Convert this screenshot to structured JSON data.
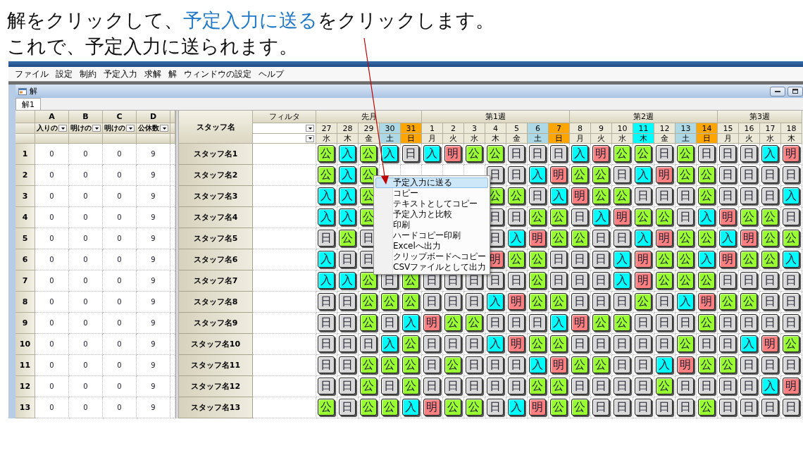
{
  "instruction": {
    "lines": [
      [
        {
          "text": "解をクリックして、",
          "highlight": false
        },
        {
          "text": "予定入力に送る",
          "highlight": true
        },
        {
          "text": "をクリックします。",
          "highlight": false
        }
      ],
      [
        {
          "text": "これで、予定入力に送られます。",
          "highlight": false
        }
      ]
    ]
  },
  "menu_bar": [
    "ファイル",
    "設定",
    "制約",
    "予定入力",
    "求解",
    "解",
    "ウィンドウの設定",
    "ヘルプ"
  ],
  "child_window": {
    "title": "解",
    "tabs": [
      {
        "label": "解1",
        "selected": true
      }
    ]
  },
  "summary_table": {
    "columns": [
      {
        "letter": "A",
        "label": "入りの"
      },
      {
        "letter": "B",
        "label": "明けの"
      },
      {
        "letter": "C",
        "label": "明けの"
      },
      {
        "letter": "D",
        "label": "公休数"
      }
    ]
  },
  "schedule": {
    "name_header": "スタッフ名",
    "filter_header": "フィルタ",
    "weeks": [
      {
        "label": "先月",
        "days": [
          {
            "date": "27",
            "weekday": "水",
            "kind": "weekday"
          },
          {
            "date": "28",
            "weekday": "木",
            "kind": "weekday"
          },
          {
            "date": "29",
            "weekday": "金",
            "kind": "weekday"
          },
          {
            "date": "30",
            "weekday": "土",
            "kind": "saturday"
          },
          {
            "date": "31",
            "weekday": "日",
            "kind": "sunday"
          }
        ]
      },
      {
        "label": "第1週",
        "days": [
          {
            "date": "1",
            "weekday": "月",
            "kind": "weekday"
          },
          {
            "date": "2",
            "weekday": "火",
            "kind": "weekday"
          },
          {
            "date": "3",
            "weekday": "水",
            "kind": "weekday"
          },
          {
            "date": "4",
            "weekday": "木",
            "kind": "weekday"
          },
          {
            "date": "5",
            "weekday": "金",
            "kind": "weekday"
          },
          {
            "date": "6",
            "weekday": "土",
            "kind": "saturday"
          },
          {
            "date": "7",
            "weekday": "日",
            "kind": "sunday"
          }
        ]
      },
      {
        "label": "第2週",
        "days": [
          {
            "date": "8",
            "weekday": "月",
            "kind": "weekday"
          },
          {
            "date": "9",
            "weekday": "火",
            "kind": "weekday"
          },
          {
            "date": "10",
            "weekday": "水",
            "kind": "weekday"
          },
          {
            "date": "11",
            "weekday": "木",
            "kind": "holiday"
          },
          {
            "date": "12",
            "weekday": "金",
            "kind": "weekday"
          },
          {
            "date": "13",
            "weekday": "土",
            "kind": "saturday"
          },
          {
            "date": "14",
            "weekday": "日",
            "kind": "sunday"
          }
        ]
      },
      {
        "label": "第3週",
        "days": [
          {
            "date": "15",
            "weekday": "月",
            "kind": "weekday"
          },
          {
            "date": "16",
            "weekday": "火",
            "kind": "weekday"
          },
          {
            "date": "17",
            "weekday": "水",
            "kind": "weekday"
          },
          {
            "date": "18",
            "weekday": "木",
            "kind": "weekday"
          }
        ]
      }
    ]
  },
  "rows": [
    {
      "number": "1",
      "values": [
        "0",
        "0",
        "0",
        "9"
      ],
      "staff": "スタッフ名1",
      "shifts": [
        {
          "label": "公",
          "color": "#99ff33"
        },
        {
          "label": "入",
          "color": "#00ffff"
        },
        {
          "label": "公",
          "color": "#99ff33"
        },
        {
          "label": "入",
          "color": "#00ffff"
        },
        {
          "label": "日",
          "color": "#d9d9d9"
        },
        {
          "label": "入",
          "color": "#00ffff"
        },
        {
          "label": "明",
          "color": "#ff8080"
        },
        {
          "label": "公",
          "color": "#99ff33"
        },
        {
          "label": "公",
          "color": "#99ff33"
        },
        {
          "label": "日",
          "color": "#d9d9d9"
        },
        {
          "label": "日",
          "color": "#d9d9d9"
        },
        {
          "label": "日",
          "color": "#d9d9d9"
        },
        {
          "label": "入",
          "color": "#00ffff"
        },
        {
          "label": "明",
          "color": "#ff8080"
        },
        {
          "label": "公",
          "color": "#99ff33"
        },
        {
          "label": "公",
          "color": "#99ff33"
        },
        {
          "label": "日",
          "color": "#d9d9d9"
        },
        {
          "label": "公",
          "color": "#99ff33"
        },
        {
          "label": "日",
          "color": "#d9d9d9"
        },
        {
          "label": "日",
          "color": "#d9d9d9"
        },
        {
          "label": "日",
          "color": "#d9d9d9"
        },
        {
          "label": "入",
          "color": "#00ffff"
        },
        {
          "label": "明",
          "color": "#ff8080"
        }
      ]
    },
    {
      "number": "2",
      "values": [
        "0",
        "0",
        "0",
        "9"
      ],
      "staff": "スタッフ名2",
      "shifts": [
        {
          "label": "公",
          "color": "#99ff33"
        },
        {
          "label": "入",
          "color": "#00ffff"
        },
        {
          "label": "公",
          "color": "#99ff33"
        }
      ],
      "shifts_right": [
        {
          "label": "日",
          "color": "#d9d9d9"
        },
        {
          "label": "日",
          "color": "#d9d9d9"
        },
        {
          "label": "入",
          "color": "#00ffff"
        },
        {
          "label": "明",
          "color": "#ff8080"
        },
        {
          "label": "公",
          "color": "#99ff33"
        },
        {
          "label": "公",
          "color": "#99ff33"
        },
        {
          "label": "日",
          "color": "#d9d9d9"
        },
        {
          "label": "入",
          "color": "#00ffff"
        },
        {
          "label": "明",
          "color": "#ff8080"
        },
        {
          "label": "公",
          "color": "#99ff33"
        },
        {
          "label": "公",
          "color": "#99ff33"
        },
        {
          "label": "日",
          "color": "#d9d9d9"
        },
        {
          "label": "日",
          "color": "#d9d9d9"
        },
        {
          "label": "日",
          "color": "#d9d9d9"
        },
        {
          "label": "日",
          "color": "#d9d9d9"
        }
      ]
    },
    {
      "number": "3",
      "values": [
        "0",
        "0",
        "0",
        "9"
      ],
      "staff": "スタッフ名3",
      "shifts": [
        {
          "label": "入",
          "color": "#00ffff"
        },
        {
          "label": "入",
          "color": "#00ffff"
        },
        {
          "label": "公",
          "color": "#99ff33"
        }
      ],
      "shifts_right": [
        {
          "label": "公",
          "color": "#99ff33"
        },
        {
          "label": "公",
          "color": "#99ff33"
        },
        {
          "label": "日",
          "color": "#d9d9d9"
        },
        {
          "label": "入",
          "color": "#00ffff"
        },
        {
          "label": "明",
          "color": "#ff8080"
        },
        {
          "label": "公",
          "color": "#99ff33"
        },
        {
          "label": "公",
          "color": "#99ff33"
        },
        {
          "label": "日",
          "color": "#d9d9d9"
        },
        {
          "label": "日",
          "color": "#d9d9d9"
        },
        {
          "label": "日",
          "color": "#d9d9d9"
        },
        {
          "label": "公",
          "color": "#99ff33"
        },
        {
          "label": "日",
          "color": "#d9d9d9"
        },
        {
          "label": "日",
          "color": "#d9d9d9"
        },
        {
          "label": "日",
          "color": "#d9d9d9"
        },
        {
          "label": "入",
          "color": "#00ffff"
        }
      ]
    },
    {
      "number": "4",
      "values": [
        "0",
        "0",
        "0",
        "9"
      ],
      "staff": "スタッフ名4",
      "shifts": [
        {
          "label": "入",
          "color": "#00ffff"
        },
        {
          "label": "入",
          "color": "#00ffff"
        },
        {
          "label": "公",
          "color": "#99ff33"
        }
      ],
      "shifts_right": [
        {
          "label": "日",
          "color": "#d9d9d9"
        },
        {
          "label": "日",
          "color": "#d9d9d9"
        },
        {
          "label": "公",
          "color": "#99ff33"
        },
        {
          "label": "公",
          "color": "#99ff33"
        },
        {
          "label": "日",
          "color": "#d9d9d9"
        },
        {
          "label": "入",
          "color": "#00ffff"
        },
        {
          "label": "明",
          "color": "#ff8080"
        },
        {
          "label": "公",
          "color": "#99ff33"
        },
        {
          "label": "公",
          "color": "#99ff33"
        },
        {
          "label": "日",
          "color": "#d9d9d9"
        },
        {
          "label": "入",
          "color": "#00ffff"
        },
        {
          "label": "明",
          "color": "#ff8080"
        },
        {
          "label": "公",
          "color": "#99ff33"
        },
        {
          "label": "公",
          "color": "#99ff33"
        },
        {
          "label": "日",
          "color": "#d9d9d9"
        }
      ]
    },
    {
      "number": "5",
      "values": [
        "0",
        "0",
        "0",
        "9"
      ],
      "staff": "スタッフ名5",
      "shifts": [
        {
          "label": "日",
          "color": "#d9d9d9"
        },
        {
          "label": "公",
          "color": "#99ff33"
        },
        {
          "label": "日",
          "color": "#d9d9d9"
        }
      ],
      "shifts_right": [
        {
          "label": "日",
          "color": "#d9d9d9"
        },
        {
          "label": "入",
          "color": "#00ffff"
        },
        {
          "label": "明",
          "color": "#ff8080"
        },
        {
          "label": "公",
          "color": "#99ff33"
        },
        {
          "label": "公",
          "color": "#99ff33"
        },
        {
          "label": "日",
          "color": "#d9d9d9"
        },
        {
          "label": "日",
          "color": "#d9d9d9"
        },
        {
          "label": "入",
          "color": "#00ffff"
        },
        {
          "label": "明",
          "color": "#ff8080"
        },
        {
          "label": "公",
          "color": "#99ff33"
        },
        {
          "label": "公",
          "color": "#99ff33"
        },
        {
          "label": "入",
          "color": "#00ffff"
        },
        {
          "label": "明",
          "color": "#ff8080"
        },
        {
          "label": "公",
          "color": "#99ff33"
        },
        {
          "label": "公",
          "color": "#99ff33"
        }
      ]
    },
    {
      "number": "6",
      "values": [
        "0",
        "0",
        "0",
        "9"
      ],
      "staff": "スタッフ名6",
      "shifts": [
        {
          "label": "入",
          "color": "#00ffff"
        },
        {
          "label": "日",
          "color": "#d9d9d9"
        },
        {
          "label": "日",
          "color": "#d9d9d9"
        }
      ],
      "shifts_right": [
        {
          "label": "明",
          "color": "#ff8080"
        },
        {
          "label": "公",
          "color": "#99ff33"
        },
        {
          "label": "公",
          "color": "#99ff33"
        },
        {
          "label": "日",
          "color": "#d9d9d9"
        },
        {
          "label": "日",
          "color": "#d9d9d9"
        },
        {
          "label": "日",
          "color": "#d9d9d9"
        },
        {
          "label": "入",
          "color": "#00ffff"
        },
        {
          "label": "明",
          "color": "#ff8080"
        },
        {
          "label": "公",
          "color": "#99ff33"
        },
        {
          "label": "公",
          "color": "#99ff33"
        },
        {
          "label": "入",
          "color": "#00ffff"
        },
        {
          "label": "明",
          "color": "#ff8080"
        },
        {
          "label": "公",
          "color": "#99ff33"
        },
        {
          "label": "公",
          "color": "#99ff33"
        },
        {
          "label": "入",
          "color": "#00ffff"
        }
      ]
    },
    {
      "number": "7",
      "values": [
        "0",
        "0",
        "0",
        "9"
      ],
      "staff": "スタッフ名7",
      "shifts": [
        {
          "label": "入",
          "color": "#00ffff"
        },
        {
          "label": "入",
          "color": "#00ffff"
        },
        {
          "label": "公",
          "color": "#99ff33"
        },
        {
          "label": "日",
          "color": "#d9d9d9"
        },
        {
          "label": "公",
          "color": "#99ff33"
        },
        {
          "label": "日",
          "color": "#d9d9d9"
        },
        {
          "label": "日",
          "color": "#d9d9d9"
        },
        {
          "label": "日",
          "color": "#d9d9d9"
        },
        {
          "label": "日",
          "color": "#d9d9d9"
        },
        {
          "label": "日",
          "color": "#d9d9d9"
        },
        {
          "label": "公",
          "color": "#99ff33"
        },
        {
          "label": "日",
          "color": "#d9d9d9"
        },
        {
          "label": "日",
          "color": "#d9d9d9"
        },
        {
          "label": "日",
          "color": "#d9d9d9"
        },
        {
          "label": "入",
          "color": "#00ffff"
        },
        {
          "label": "明",
          "color": "#ff8080"
        },
        {
          "label": "公",
          "color": "#99ff33"
        },
        {
          "label": "公",
          "color": "#99ff33"
        },
        {
          "label": "公",
          "color": "#99ff33"
        },
        {
          "label": "日",
          "color": "#d9d9d9"
        },
        {
          "label": "日",
          "color": "#d9d9d9"
        },
        {
          "label": "日",
          "color": "#d9d9d9"
        },
        {
          "label": "日",
          "color": "#d9d9d9"
        }
      ]
    },
    {
      "number": "8",
      "values": [
        "0",
        "0",
        "0",
        "9"
      ],
      "staff": "スタッフ名8",
      "shifts": [
        {
          "label": "日",
          "color": "#d9d9d9"
        },
        {
          "label": "日",
          "color": "#d9d9d9"
        },
        {
          "label": "公",
          "color": "#99ff33"
        },
        {
          "label": "公",
          "color": "#99ff33"
        },
        {
          "label": "公",
          "color": "#99ff33"
        },
        {
          "label": "日",
          "color": "#d9d9d9"
        },
        {
          "label": "日",
          "color": "#d9d9d9"
        },
        {
          "label": "日",
          "color": "#d9d9d9"
        },
        {
          "label": "入",
          "color": "#00ffff"
        },
        {
          "label": "明",
          "color": "#ff8080"
        },
        {
          "label": "公",
          "color": "#99ff33"
        },
        {
          "label": "公",
          "color": "#99ff33"
        },
        {
          "label": "日",
          "color": "#d9d9d9"
        },
        {
          "label": "日",
          "color": "#d9d9d9"
        },
        {
          "label": "日",
          "color": "#d9d9d9"
        },
        {
          "label": "公",
          "color": "#99ff33"
        },
        {
          "label": "日",
          "color": "#d9d9d9"
        },
        {
          "label": "入",
          "color": "#00ffff"
        },
        {
          "label": "明",
          "color": "#ff8080"
        },
        {
          "label": "公",
          "color": "#99ff33"
        },
        {
          "label": "公",
          "color": "#99ff33"
        },
        {
          "label": "日",
          "color": "#d9d9d9"
        },
        {
          "label": "日",
          "color": "#d9d9d9"
        }
      ]
    },
    {
      "number": "9",
      "values": [
        "0",
        "0",
        "0",
        "9"
      ],
      "staff": "スタッフ名9",
      "shifts": [
        {
          "label": "日",
          "color": "#d9d9d9"
        },
        {
          "label": "日",
          "color": "#d9d9d9"
        },
        {
          "label": "公",
          "color": "#99ff33"
        },
        {
          "label": "日",
          "color": "#d9d9d9"
        },
        {
          "label": "入",
          "color": "#00ffff"
        },
        {
          "label": "明",
          "color": "#ff8080"
        },
        {
          "label": "公",
          "color": "#99ff33"
        },
        {
          "label": "公",
          "color": "#99ff33"
        },
        {
          "label": "日",
          "color": "#d9d9d9"
        },
        {
          "label": "日",
          "color": "#d9d9d9"
        },
        {
          "label": "日",
          "color": "#d9d9d9"
        },
        {
          "label": "入",
          "color": "#00ffff"
        },
        {
          "label": "明",
          "color": "#ff8080"
        },
        {
          "label": "公",
          "color": "#99ff33"
        },
        {
          "label": "公",
          "color": "#99ff33"
        },
        {
          "label": "日",
          "color": "#d9d9d9"
        },
        {
          "label": "日",
          "color": "#d9d9d9"
        },
        {
          "label": "日",
          "color": "#d9d9d9"
        },
        {
          "label": "公",
          "color": "#99ff33"
        },
        {
          "label": "日",
          "color": "#d9d9d9"
        },
        {
          "label": "日",
          "color": "#d9d9d9"
        },
        {
          "label": "日",
          "color": "#d9d9d9"
        },
        {
          "label": "日",
          "color": "#d9d9d9"
        }
      ]
    },
    {
      "number": "10",
      "values": [
        "0",
        "0",
        "0",
        "9"
      ],
      "staff": "スタッフ名10",
      "shifts": [
        {
          "label": "日",
          "color": "#d9d9d9"
        },
        {
          "label": "日",
          "color": "#d9d9d9"
        },
        {
          "label": "日",
          "color": "#d9d9d9"
        },
        {
          "label": "入",
          "color": "#00ffff"
        },
        {
          "label": "公",
          "color": "#99ff33"
        },
        {
          "label": "日",
          "color": "#d9d9d9"
        },
        {
          "label": "日",
          "color": "#d9d9d9"
        },
        {
          "label": "日",
          "color": "#d9d9d9"
        },
        {
          "label": "入",
          "color": "#00ffff"
        },
        {
          "label": "明",
          "color": "#ff8080"
        },
        {
          "label": "公",
          "color": "#99ff33"
        },
        {
          "label": "公",
          "color": "#99ff33"
        },
        {
          "label": "日",
          "color": "#d9d9d9"
        },
        {
          "label": "日",
          "color": "#d9d9d9"
        },
        {
          "label": "日",
          "color": "#d9d9d9"
        },
        {
          "label": "日",
          "color": "#d9d9d9"
        },
        {
          "label": "日",
          "color": "#d9d9d9"
        },
        {
          "label": "公",
          "color": "#99ff33"
        },
        {
          "label": "日",
          "color": "#d9d9d9"
        },
        {
          "label": "日",
          "color": "#d9d9d9"
        },
        {
          "label": "入",
          "color": "#00ffff"
        },
        {
          "label": "明",
          "color": "#ff8080"
        },
        {
          "label": "公",
          "color": "#99ff33"
        }
      ]
    },
    {
      "number": "11",
      "values": [
        "0",
        "0",
        "0",
        "9"
      ],
      "staff": "スタッフ名11",
      "shifts": [
        {
          "label": "日",
          "color": "#d9d9d9"
        },
        {
          "label": "日",
          "color": "#d9d9d9"
        },
        {
          "label": "公",
          "color": "#99ff33"
        },
        {
          "label": "公",
          "color": "#99ff33"
        },
        {
          "label": "公",
          "color": "#99ff33"
        },
        {
          "label": "日",
          "color": "#d9d9d9"
        },
        {
          "label": "公",
          "color": "#99ff33"
        },
        {
          "label": "日",
          "color": "#d9d9d9"
        },
        {
          "label": "日",
          "color": "#d9d9d9"
        },
        {
          "label": "日",
          "color": "#d9d9d9"
        },
        {
          "label": "入",
          "color": "#00ffff"
        },
        {
          "label": "明",
          "color": "#ff8080"
        },
        {
          "label": "公",
          "color": "#99ff33"
        },
        {
          "label": "公",
          "color": "#99ff33"
        },
        {
          "label": "日",
          "color": "#d9d9d9"
        },
        {
          "label": "日",
          "color": "#d9d9d9"
        },
        {
          "label": "入",
          "color": "#00ffff"
        },
        {
          "label": "明",
          "color": "#ff8080"
        },
        {
          "label": "公",
          "color": "#99ff33"
        },
        {
          "label": "公",
          "color": "#99ff33"
        },
        {
          "label": "日",
          "color": "#d9d9d9"
        },
        {
          "label": "日",
          "color": "#d9d9d9"
        },
        {
          "label": "日",
          "color": "#d9d9d9"
        }
      ]
    },
    {
      "number": "12",
      "values": [
        "0",
        "0",
        "0",
        "9"
      ],
      "staff": "スタッフ名12",
      "shifts": [
        {
          "label": "日",
          "color": "#d9d9d9"
        },
        {
          "label": "日",
          "color": "#d9d9d9"
        },
        {
          "label": "公",
          "color": "#99ff33"
        },
        {
          "label": "日",
          "color": "#d9d9d9"
        },
        {
          "label": "公",
          "color": "#99ff33"
        },
        {
          "label": "日",
          "color": "#d9d9d9"
        },
        {
          "label": "日",
          "color": "#d9d9d9"
        },
        {
          "label": "日",
          "color": "#d9d9d9"
        },
        {
          "label": "日",
          "color": "#d9d9d9"
        },
        {
          "label": "日",
          "color": "#d9d9d9"
        },
        {
          "label": "公",
          "color": "#99ff33"
        },
        {
          "label": "公",
          "color": "#99ff33"
        },
        {
          "label": "日",
          "color": "#d9d9d9"
        },
        {
          "label": "日",
          "color": "#d9d9d9"
        },
        {
          "label": "日",
          "color": "#d9d9d9"
        },
        {
          "label": "日",
          "color": "#d9d9d9"
        },
        {
          "label": "公",
          "color": "#99ff33"
        },
        {
          "label": "日",
          "color": "#d9d9d9"
        },
        {
          "label": "日",
          "color": "#d9d9d9"
        },
        {
          "label": "日",
          "color": "#d9d9d9"
        },
        {
          "label": "日",
          "color": "#d9d9d9"
        },
        {
          "label": "入",
          "color": "#00ffff"
        },
        {
          "label": "明",
          "color": "#ff8080"
        }
      ]
    },
    {
      "number": "13",
      "values": [
        "0",
        "0",
        "0",
        "9"
      ],
      "staff": "スタッフ名13",
      "shifts": [
        {
          "label": "公",
          "color": "#99ff33"
        },
        {
          "label": "日",
          "color": "#d9d9d9"
        },
        {
          "label": "公",
          "color": "#99ff33"
        },
        {
          "label": "公",
          "color": "#99ff33"
        },
        {
          "label": "入",
          "color": "#00ffff"
        },
        {
          "label": "明",
          "color": "#ff8080"
        },
        {
          "label": "公",
          "color": "#99ff33"
        },
        {
          "label": "公",
          "color": "#99ff33"
        },
        {
          "label": "日",
          "color": "#d9d9d9"
        },
        {
          "label": "入",
          "color": "#00ffff"
        },
        {
          "label": "明",
          "color": "#ff8080"
        },
        {
          "label": "公",
          "color": "#99ff33"
        },
        {
          "label": "公",
          "color": "#99ff33"
        },
        {
          "label": "日",
          "color": "#d9d9d9"
        },
        {
          "label": "日",
          "color": "#d9d9d9"
        },
        {
          "label": "日",
          "color": "#d9d9d9"
        },
        {
          "label": "日",
          "color": "#d9d9d9"
        },
        {
          "label": "日",
          "color": "#d9d9d9"
        },
        {
          "label": "公",
          "color": "#99ff33"
        },
        {
          "label": "日",
          "color": "#d9d9d9"
        },
        {
          "label": "日",
          "color": "#d9d9d9"
        },
        {
          "label": "日",
          "color": "#d9d9d9"
        },
        {
          "label": "日",
          "color": "#d9d9d9"
        }
      ]
    }
  ],
  "context_menu": {
    "items": [
      {
        "label": "予定入力に送る",
        "selected": true
      },
      {
        "label": "コピー",
        "selected": false
      },
      {
        "label": "テキストとしてコピー",
        "selected": false
      },
      {
        "label": "予定入力と比較",
        "selected": false
      },
      {
        "label": "印刷",
        "selected": false
      },
      {
        "label": "ハードコピー印刷",
        "selected": false
      },
      {
        "label": "Excelへ出力",
        "selected": false
      },
      {
        "label": "クリップボードへコピー",
        "selected": false
      },
      {
        "label": "CSVファイルとして出力",
        "selected": false
      }
    ]
  }
}
